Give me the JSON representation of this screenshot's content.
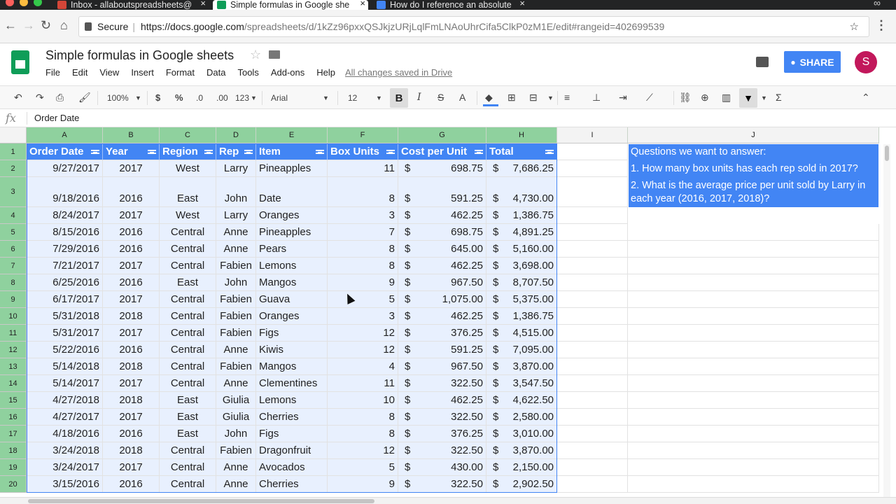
{
  "browser": {
    "tabs": [
      {
        "title": "Inbox - allaboutspreadsheets@",
        "active": false,
        "icon": "gmail-icon"
      },
      {
        "title": "Simple formulas in Google she",
        "active": true,
        "icon": "sheets-icon"
      },
      {
        "title": "How do I reference an absolute",
        "active": false,
        "icon": "docs-icon"
      }
    ],
    "secure_label": "Secure",
    "url_host": "https://docs.google.com",
    "url_path": "/spreadsheets/d/1kZz96pxxQSJkjzURjLqlFmLNAoUhrCifa5ClkP0zM1E/edit#rangeid=402699539"
  },
  "doc": {
    "title": "Simple formulas in Google sheets",
    "menus": [
      "File",
      "Edit",
      "View",
      "Insert",
      "Format",
      "Data",
      "Tools",
      "Add-ons",
      "Help"
    ],
    "saved_status": "All changes saved in Drive",
    "share_label": "SHARE",
    "avatar_letter": "S"
  },
  "toolbar": {
    "zoom": "100%",
    "currency": "$",
    "percent": "%",
    "dec_less": ".0",
    "dec_more": ".00",
    "format_more": "123",
    "font": "Arial",
    "font_size": "12",
    "bold": "B",
    "italic": "I",
    "strike": "S",
    "text_color": "A",
    "function": "Σ"
  },
  "formula_bar": {
    "fx": "fx",
    "value": "Order Date"
  },
  "columns": [
    "A",
    "B",
    "C",
    "D",
    "E",
    "F",
    "G",
    "H",
    "I",
    "J"
  ],
  "rows": [
    "1",
    "2",
    "3",
    "4",
    "5",
    "6",
    "7",
    "8",
    "9",
    "10",
    "11",
    "12",
    "13",
    "14",
    "15",
    "16",
    "17",
    "18",
    "19",
    "20"
  ],
  "headers": [
    "Order Date",
    "Year",
    "Region",
    "Rep",
    "Item",
    "Box Units",
    "Cost per Unit",
    "Total"
  ],
  "data": [
    [
      "9/27/2017",
      "2017",
      "West",
      "Larry",
      "Pineapples",
      "11",
      "$",
      "698.75",
      "$",
      "7,686.25"
    ],
    [
      "9/18/2016",
      "2016",
      "East",
      "John",
      "Date",
      "8",
      "$",
      "591.25",
      "$",
      "4,730.00"
    ],
    [
      "8/24/2017",
      "2017",
      "West",
      "Larry",
      "Oranges",
      "3",
      "$",
      "462.25",
      "$",
      "1,386.75"
    ],
    [
      "8/15/2016",
      "2016",
      "Central",
      "Anne",
      "Pineapples",
      "7",
      "$",
      "698.75",
      "$",
      "4,891.25"
    ],
    [
      "7/29/2016",
      "2016",
      "Central",
      "Anne",
      "Pears",
      "8",
      "$",
      "645.00",
      "$",
      "5,160.00"
    ],
    [
      "7/21/2017",
      "2017",
      "Central",
      "Fabien",
      "Lemons",
      "8",
      "$",
      "462.25",
      "$",
      "3,698.00"
    ],
    [
      "6/25/2016",
      "2016",
      "East",
      "John",
      "Mangos",
      "9",
      "$",
      "967.50",
      "$",
      "8,707.50"
    ],
    [
      "6/17/2017",
      "2017",
      "Central",
      "Fabien",
      "Guava",
      "5",
      "$",
      "1,075.00",
      "$",
      "5,375.00"
    ],
    [
      "5/31/2018",
      "2018",
      "Central",
      "Fabien",
      "Oranges",
      "3",
      "$",
      "462.25",
      "$",
      "1,386.75"
    ],
    [
      "5/31/2017",
      "2017",
      "Central",
      "Fabien",
      "Figs",
      "12",
      "$",
      "376.25",
      "$",
      "4,515.00"
    ],
    [
      "5/22/2016",
      "2016",
      "Central",
      "Anne",
      "Kiwis",
      "12",
      "$",
      "591.25",
      "$",
      "7,095.00"
    ],
    [
      "5/14/2018",
      "2018",
      "Central",
      "Fabien",
      "Mangos",
      "4",
      "$",
      "967.50",
      "$",
      "3,870.00"
    ],
    [
      "5/14/2017",
      "2017",
      "Central",
      "Anne",
      "Clementines",
      "11",
      "$",
      "322.50",
      "$",
      "3,547.50"
    ],
    [
      "4/27/2018",
      "2018",
      "East",
      "Giulia",
      "Lemons",
      "10",
      "$",
      "462.25",
      "$",
      "4,622.50"
    ],
    [
      "4/27/2017",
      "2017",
      "East",
      "Giulia",
      "Cherries",
      "8",
      "$",
      "322.50",
      "$",
      "2,580.00"
    ],
    [
      "4/18/2016",
      "2016",
      "East",
      "John",
      "Figs",
      "8",
      "$",
      "376.25",
      "$",
      "3,010.00"
    ],
    [
      "3/24/2018",
      "2018",
      "Central",
      "Fabien",
      "Dragonfruit",
      "12",
      "$",
      "322.50",
      "$",
      "3,870.00"
    ],
    [
      "3/24/2017",
      "2017",
      "Central",
      "Anne",
      "Avocados",
      "5",
      "$",
      "430.00",
      "$",
      "2,150.00"
    ],
    [
      "3/15/2016",
      "2016",
      "Central",
      "Anne",
      "Cherries",
      "9",
      "$",
      "322.50",
      "$",
      "2,902.50"
    ]
  ],
  "questions": [
    "Questions we want to answer:",
    "1. How many box units has each rep sold in 2017?",
    "2. What is the average price per unit sold by Larry in each year (2016, 2017, 2018)?"
  ],
  "colors": {
    "header_blue": "#4285f4",
    "selection_blue": "#e8f0fe",
    "column_header_green": "#8fd19e",
    "sheets_green": "#0f9d58"
  }
}
